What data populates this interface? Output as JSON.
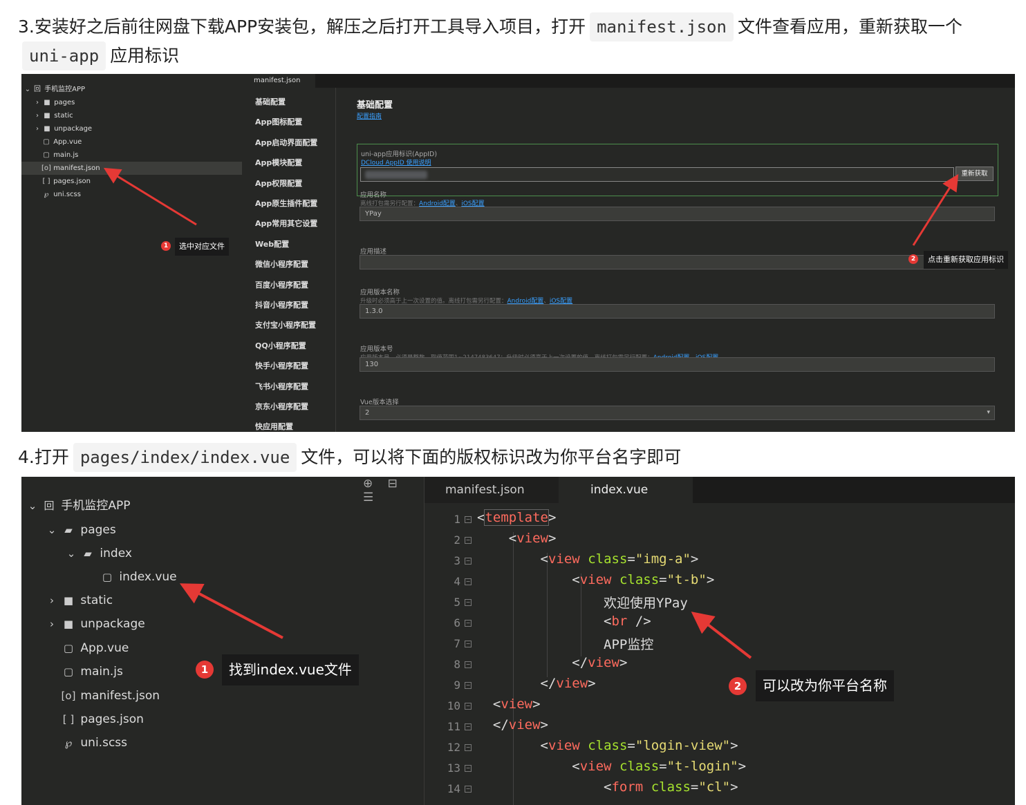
{
  "step3": {
    "before": "3.安装好之后前往网盘下载APP安装包，解压之后打开工具导入项目，打开",
    "code1": "manifest.json",
    "middle": "文件查看应用，重新获取一个",
    "code2": "uni-app",
    "after": "应用标识"
  },
  "step4": {
    "before": "4.打开",
    "code": "pages/index/index.vue",
    "after": "文件，可以将下面的版权标识改为你平台名字即可"
  },
  "shot1": {
    "tree": [
      {
        "label": "手机监控APP",
        "icon": "app-icon",
        "glyph": "回",
        "arrow": "⌄"
      },
      {
        "label": "pages",
        "icon": "folder-icon",
        "glyph": "■",
        "arrow": "›"
      },
      {
        "label": "static",
        "icon": "folder-icon",
        "glyph": "■",
        "arrow": "›"
      },
      {
        "label": "unpackage",
        "icon": "folder-icon",
        "glyph": "■",
        "arrow": "›"
      },
      {
        "label": "App.vue",
        "icon": "vue-file-icon",
        "glyph": "▢",
        "arrow": ""
      },
      {
        "label": "main.js",
        "icon": "js-file-icon",
        "glyph": "▢",
        "arrow": ""
      },
      {
        "label": "manifest.json",
        "icon": "manifest-file-icon",
        "glyph": "[o]",
        "arrow": ""
      },
      {
        "label": "pages.json",
        "icon": "json-file-icon",
        "glyph": "[ ]",
        "arrow": ""
      },
      {
        "label": "uni.scss",
        "icon": "scss-file-icon",
        "glyph": "℘",
        "arrow": ""
      }
    ],
    "tab": "manifest.json",
    "nav": [
      "基础配置",
      "App图标配置",
      "App启动界面配置",
      "App模块配置",
      "App权限配置",
      "App原生插件配置",
      "App常用其它设置",
      "Web配置",
      "微信小程序配置",
      "百度小程序配置",
      "抖音小程序配置",
      "支付宝小程序配置",
      "QQ小程序配置",
      "快手小程序配置",
      "飞书小程序配置",
      "京东小程序配置",
      "快应用配置"
    ],
    "form": {
      "title": "基础配置",
      "guide_link": "配置指南",
      "appid_label": "uni-app应用标识(AppID)",
      "appid_link": "DCloud AppID 使用说明",
      "refetch": "重新获取",
      "name_label": "应用名称",
      "name_hint": "离线打包需另行配置：",
      "android_link": "Android配置",
      "sep": "、",
      "ios_link": "iOS配置",
      "name_value": "YPay",
      "desc_label": "应用描述",
      "version_name_label": "应用版本名称",
      "version_name_hint": "升级时必须高于上一次设置的值。离线打包需另行配置：",
      "version_name_value": "1.3.0",
      "version_code_label": "应用版本号",
      "version_code_hint": "应用版本号，必须是整数，取值范围1~2147483647；升级时必须高于上一次设置的值。离线打包需另行配置：",
      "version_code_value": "130",
      "vue_label": "Vue版本选择",
      "vue_value": "2"
    },
    "callout1": {
      "num": "1",
      "text": "选中对应文件"
    },
    "callout2": {
      "num": "2",
      "text": "点击重新获取应用标识"
    }
  },
  "shot2": {
    "toolbar_icons": [
      "target-icon",
      "collapse-icon",
      "menu-icon"
    ],
    "toolbar_glyphs": "⊕ ⊟ ☰",
    "tree": [
      {
        "label": "手机监控APP",
        "glyph": "回",
        "arrow": "⌄",
        "indent": 0
      },
      {
        "label": "pages",
        "glyph": "▰",
        "arrow": "⌄",
        "indent": 1
      },
      {
        "label": "index",
        "glyph": "▰",
        "arrow": "⌄",
        "indent": 2
      },
      {
        "label": "index.vue",
        "glyph": "▢",
        "arrow": "",
        "indent": 3
      },
      {
        "label": "static",
        "glyph": "■",
        "arrow": "›",
        "indent": 1
      },
      {
        "label": "unpackage",
        "glyph": "■",
        "arrow": "›",
        "indent": 1
      },
      {
        "label": "App.vue",
        "glyph": "▢",
        "arrow": "",
        "indent": 1
      },
      {
        "label": "main.js",
        "glyph": "▢",
        "arrow": "",
        "indent": 1
      },
      {
        "label": "manifest.json",
        "glyph": "[o]",
        "arrow": "",
        "indent": 1
      },
      {
        "label": "pages.json",
        "glyph": "[ ]",
        "arrow": "",
        "indent": 1
      },
      {
        "label": "uni.scss",
        "glyph": "℘",
        "arrow": "",
        "indent": 1
      }
    ],
    "tabs": [
      "manifest.json",
      "index.vue"
    ],
    "lines": [
      "1",
      "2",
      "3",
      "4",
      "5",
      "6",
      "7",
      "8",
      "9",
      "10",
      "11",
      "12",
      "13",
      "14"
    ],
    "callout1": {
      "num": "1",
      "text": "找到index.vue文件"
    },
    "callout2": {
      "num": "2",
      "text": "可以改为你平台名称"
    }
  },
  "code": {
    "template_open": "template",
    "view": "view",
    "class_attr": "class",
    "img_a": "\"img-a\"",
    "t_b": "\"t-b\"",
    "welcome": "欢迎使用YPay",
    "br": "br",
    "app_monitor": "APP监控",
    "login_view": "\"login-view\"",
    "t_login": "\"t-login\"",
    "form": "form",
    "cl": "\"cl\""
  }
}
